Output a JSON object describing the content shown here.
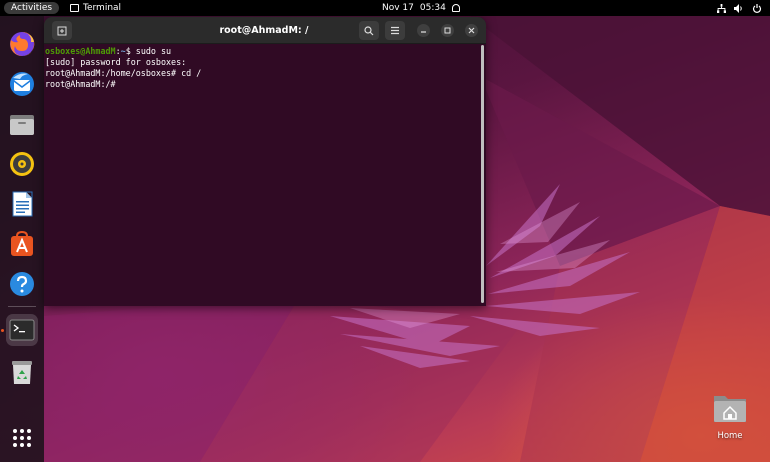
{
  "topbar": {
    "activities_label": "Activities",
    "app_name": "Terminal",
    "date": "Nov 17",
    "time": "05:34"
  },
  "dock": {
    "items": [
      {
        "name": "Firefox",
        "icon": "firefox-icon"
      },
      {
        "name": "Thunderbird Mail",
        "icon": "thunderbird-icon"
      },
      {
        "name": "Files",
        "icon": "files-icon"
      },
      {
        "name": "Rhythmbox",
        "icon": "rhythmbox-icon"
      },
      {
        "name": "LibreOffice Writer",
        "icon": "libreoffice-writer-icon"
      },
      {
        "name": "Ubuntu Software",
        "icon": "ubuntu-software-icon"
      },
      {
        "name": "Help",
        "icon": "help-icon"
      },
      {
        "name": "Terminal",
        "icon": "terminal-icon",
        "running": true
      },
      {
        "name": "Trash",
        "icon": "trash-icon"
      },
      {
        "name": "Show Applications",
        "icon": "app-grid-icon"
      }
    ]
  },
  "terminal": {
    "title": "root@AhmadM: /",
    "lines": {
      "l1_user": "osboxes@AhmadM",
      "l1_sep": ":",
      "l1_path": "~",
      "l1_rest": "$ sudo su",
      "l2": "[sudo] password for osboxes:",
      "l3": "root@AhmadM:/home/osboxes# cd /",
      "l4": "root@AhmadM:/#"
    }
  },
  "desktop": {
    "home_label": "Home"
  },
  "colors": {
    "terminal_bg": "#300a24",
    "prompt_green": "#4e9a06",
    "prompt_blue": "#729fcf",
    "accent_orange": "#e95420"
  }
}
